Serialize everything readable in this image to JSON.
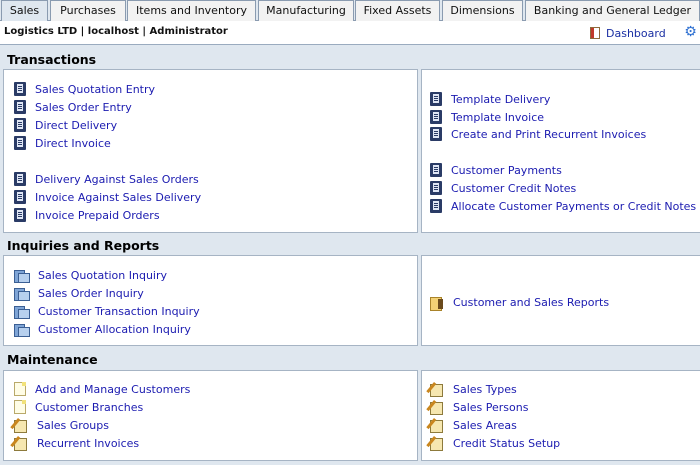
{
  "tabs": [
    {
      "label": "Sales",
      "active": true
    },
    {
      "label": "Purchases",
      "active": false
    },
    {
      "label": "Items and Inventory",
      "active": false
    },
    {
      "label": "Manufacturing",
      "active": false
    },
    {
      "label": "Fixed Assets",
      "active": false
    },
    {
      "label": "Dimensions",
      "active": false
    },
    {
      "label": "Banking and General Ledger",
      "active": false
    }
  ],
  "infobar": {
    "company": "Logistics LTD | localhost | Administrator",
    "dashboard_label": "Dashboard"
  },
  "sections": {
    "transactions": {
      "title": "Transactions",
      "left": [
        "Sales Quotation Entry",
        "Sales Order Entry",
        "Direct Delivery",
        "Direct Invoice",
        "Delivery Against Sales Orders",
        "Invoice Against Sales Delivery",
        "Invoice Prepaid Orders"
      ],
      "right": [
        "Template Delivery",
        "Template Invoice",
        "Create and Print Recurrent Invoices",
        "Customer Payments",
        "Customer Credit Notes",
        "Allocate Customer Payments or Credit Notes"
      ]
    },
    "inquiries": {
      "title": "Inquiries and Reports",
      "left": [
        "Sales Quotation Inquiry",
        "Sales Order Inquiry",
        "Customer Transaction Inquiry",
        "Customer Allocation Inquiry"
      ],
      "right": [
        "Customer and Sales Reports"
      ]
    },
    "maintenance": {
      "title": "Maintenance",
      "left": [
        "Add and Manage Customers",
        "Customer Branches",
        "Sales Groups",
        "Recurrent Invoices"
      ],
      "right": [
        "Sales Types",
        "Sales Persons",
        "Sales Areas",
        "Credit Status Setup"
      ]
    }
  },
  "accent_link_color": "#1b1bb0",
  "background_color": "#dfe7ef"
}
